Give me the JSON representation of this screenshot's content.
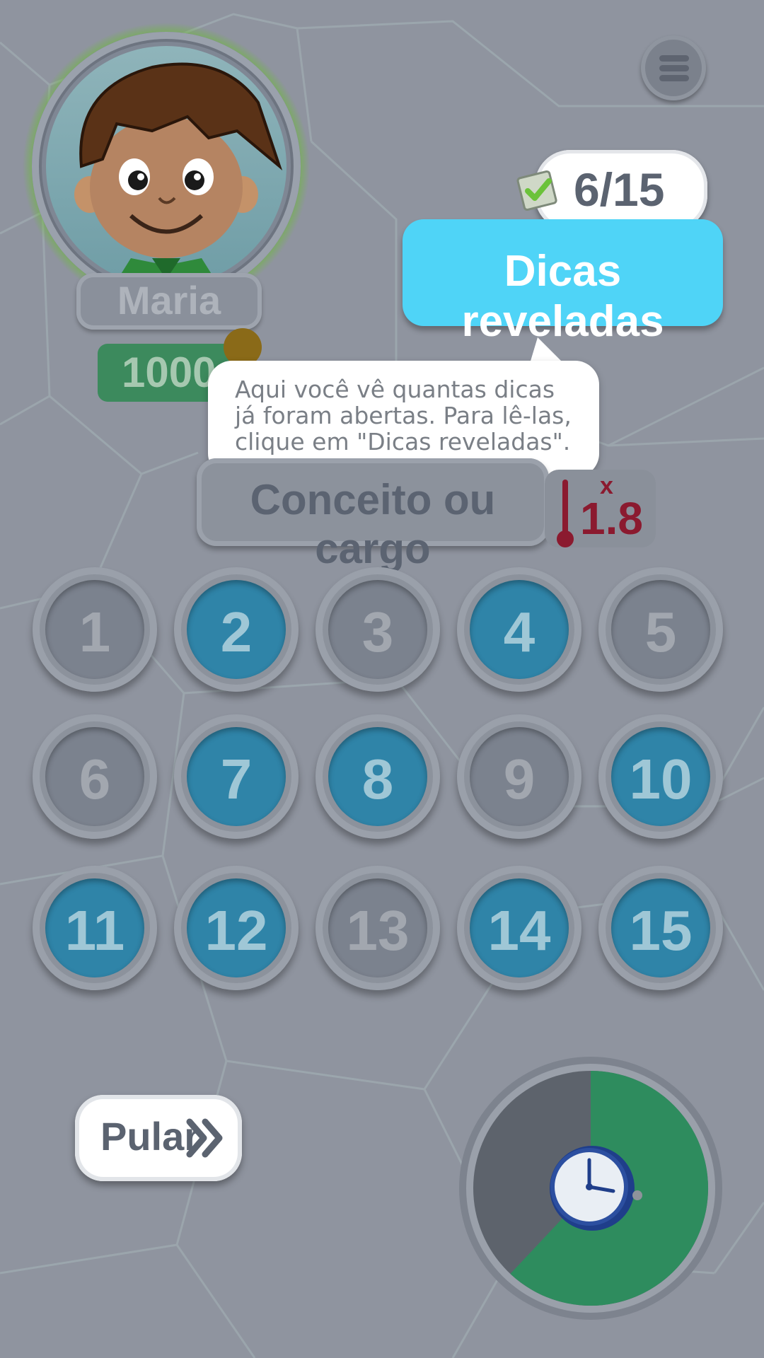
{
  "player": {
    "name": "Maria",
    "score": "1000"
  },
  "menu": {
    "icon": "hamburger-icon"
  },
  "hints_counter": {
    "revealed": 6,
    "total": 15,
    "label": "6/15",
    "icon": "checklist-icon"
  },
  "dicas_button": {
    "label": "Dicas reveladas"
  },
  "tooltip": {
    "text": "Aqui você vê quantas dicas já foram abertas. Para lê-las, clique em \"Dicas reveladas\"."
  },
  "category": {
    "label": "Conceito ou cargo"
  },
  "multiplier": {
    "x": "x",
    "value": "1.8",
    "icon": "thermometer-icon"
  },
  "hints": [
    {
      "number": "1",
      "revealed": false
    },
    {
      "number": "2",
      "revealed": true
    },
    {
      "number": "3",
      "revealed": false
    },
    {
      "number": "4",
      "revealed": true
    },
    {
      "number": "5",
      "revealed": false
    },
    {
      "number": "6",
      "revealed": false
    },
    {
      "number": "7",
      "revealed": true
    },
    {
      "number": "8",
      "revealed": true
    },
    {
      "number": "9",
      "revealed": false
    },
    {
      "number": "10",
      "revealed": true
    },
    {
      "number": "11",
      "revealed": true
    },
    {
      "number": "12",
      "revealed": true
    },
    {
      "number": "13",
      "revealed": false
    },
    {
      "number": "14",
      "revealed": true
    },
    {
      "number": "15",
      "revealed": true
    }
  ],
  "skip_button": {
    "label": "Pular",
    "icon": "double-chevron-right-icon"
  },
  "timer": {
    "remaining_fraction": 0.62,
    "icon": "clock-icon"
  },
  "colors": {
    "revealed_hint": "#2f84a8",
    "hidden_hint": "#7b828e",
    "dicas_button": "#4fd4f7",
    "timer_remaining": "#2e8c5e",
    "timer_elapsed": "#5d636c",
    "multiplier": "#8b1a2f",
    "score_plate": "#3c8a5d"
  }
}
